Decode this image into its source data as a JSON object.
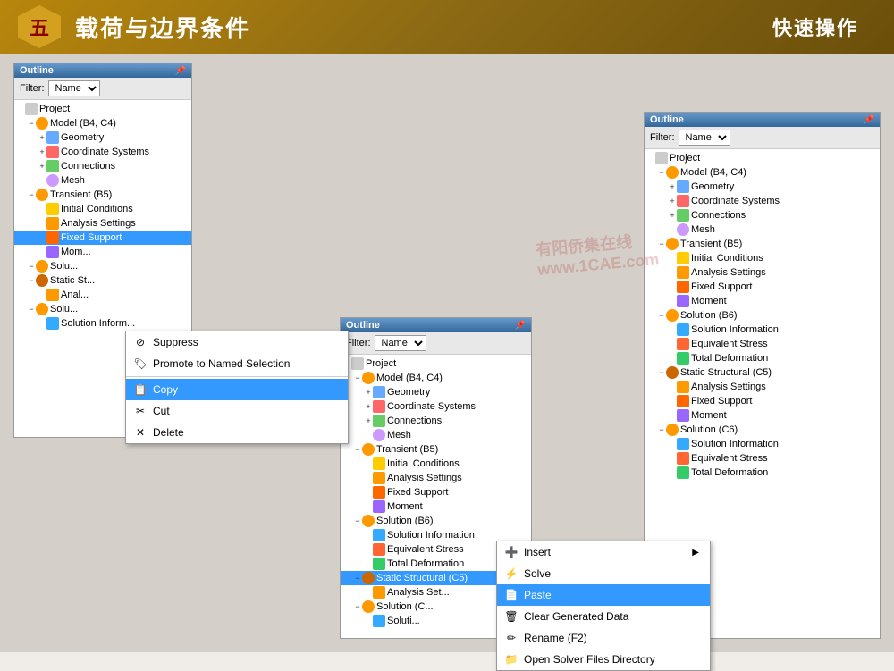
{
  "header": {
    "badge": "五",
    "title": "载荷与边界条件",
    "subtitle": "快速操作"
  },
  "panel1": {
    "title": "Outline",
    "filter_label": "Filter:",
    "filter_value": "Name",
    "tree": [
      {
        "id": "project",
        "label": "Project",
        "icon": "project",
        "indent": 0,
        "expand": ""
      },
      {
        "id": "model",
        "label": "Model (B4, C4)",
        "icon": "model",
        "indent": 1,
        "expand": "−"
      },
      {
        "id": "geometry",
        "label": "Geometry",
        "icon": "geometry",
        "indent": 2,
        "expand": "+"
      },
      {
        "id": "coord",
        "label": "Coordinate Systems",
        "icon": "coord",
        "indent": 2,
        "expand": "+"
      },
      {
        "id": "connect",
        "label": "Connections",
        "icon": "connect",
        "indent": 2,
        "expand": "+"
      },
      {
        "id": "mesh",
        "label": "Mesh",
        "icon": "mesh",
        "indent": 2,
        "expand": ""
      },
      {
        "id": "transient",
        "label": "Transient (B5)",
        "icon": "transient",
        "indent": 1,
        "expand": "−"
      },
      {
        "id": "init",
        "label": "Initial Conditions",
        "icon": "init",
        "indent": 2,
        "expand": ""
      },
      {
        "id": "analysis",
        "label": "Analysis Settings",
        "icon": "analysis",
        "indent": 2,
        "expand": ""
      },
      {
        "id": "fixed",
        "label": "Fixed Support",
        "icon": "fixed",
        "indent": 2,
        "expand": "",
        "selected": true
      },
      {
        "id": "moment",
        "label": "Mom...",
        "icon": "moment",
        "indent": 2,
        "expand": ""
      },
      {
        "id": "solu_b",
        "label": "Solu...",
        "icon": "solution",
        "indent": 1,
        "expand": "−"
      },
      {
        "id": "static_st",
        "label": "Static St...",
        "icon": "static",
        "indent": 1,
        "expand": "−"
      },
      {
        "id": "anal2",
        "label": "Anal...",
        "icon": "analysis",
        "indent": 2,
        "expand": ""
      },
      {
        "id": "solu_c",
        "label": "Solu...",
        "icon": "solution",
        "indent": 1,
        "expand": "−"
      },
      {
        "id": "sol_info2",
        "label": "Solution Inform...",
        "icon": "sol-info",
        "indent": 2,
        "expand": ""
      }
    ]
  },
  "context_menu1": {
    "items": [
      {
        "label": "Suppress",
        "icon": "suppress",
        "type": "item"
      },
      {
        "label": "Promote to Named Selection",
        "icon": "promote",
        "type": "item"
      },
      {
        "label": "Copy",
        "icon": "copy",
        "type": "item",
        "highlighted": true
      },
      {
        "label": "Cut",
        "icon": "cut",
        "type": "item"
      },
      {
        "label": "Delete",
        "icon": "delete",
        "type": "item"
      }
    ]
  },
  "panel2": {
    "title": "Outline",
    "filter_label": "Filter:",
    "filter_value": "Name",
    "tree": [
      {
        "id": "project",
        "label": "Project",
        "icon": "project",
        "indent": 0
      },
      {
        "id": "model",
        "label": "Model (B4, C4)",
        "icon": "model",
        "indent": 1,
        "expand": "−"
      },
      {
        "id": "geometry",
        "label": "Geometry",
        "icon": "geometry",
        "indent": 2,
        "expand": "+"
      },
      {
        "id": "coord",
        "label": "Coordinate Systems",
        "icon": "coord",
        "indent": 2,
        "expand": "+"
      },
      {
        "id": "connect",
        "label": "Connections",
        "icon": "connect",
        "indent": 2,
        "expand": "+"
      },
      {
        "id": "mesh",
        "label": "Mesh",
        "icon": "mesh",
        "indent": 2
      },
      {
        "id": "transient",
        "label": "Transient (B5)",
        "icon": "transient",
        "indent": 1,
        "expand": "−"
      },
      {
        "id": "init",
        "label": "Initial Conditions",
        "icon": "init",
        "indent": 2
      },
      {
        "id": "analysis",
        "label": "Analysis Settings",
        "icon": "analysis",
        "indent": 2
      },
      {
        "id": "fixed",
        "label": "Fixed Support",
        "icon": "fixed",
        "indent": 2
      },
      {
        "id": "moment",
        "label": "Moment",
        "icon": "moment",
        "indent": 2
      },
      {
        "id": "solution_b6",
        "label": "Solution (B6)",
        "icon": "solution",
        "indent": 1,
        "expand": "−"
      },
      {
        "id": "sol_info",
        "label": "Solution Information",
        "icon": "sol-info",
        "indent": 2
      },
      {
        "id": "equiv",
        "label": "Equivalent Stress",
        "icon": "equiv",
        "indent": 2
      },
      {
        "id": "deform",
        "label": "Total Deformation",
        "icon": "deform",
        "indent": 2
      },
      {
        "id": "static_c5",
        "label": "Static Structural (C5)",
        "icon": "static",
        "indent": 1,
        "expand": "−",
        "highlighted": true
      },
      {
        "id": "anal_set",
        "label": "Analysis Set...",
        "icon": "analysis",
        "indent": 2
      },
      {
        "id": "solu_c6q",
        "label": "Solution (C...",
        "icon": "solution",
        "indent": 1,
        "expand": "−"
      },
      {
        "id": "sol_c6",
        "label": "Soluti...",
        "icon": "sol-info",
        "indent": 2
      }
    ]
  },
  "context_menu2": {
    "items": [
      {
        "label": "Insert",
        "icon": "insert",
        "type": "submenu"
      },
      {
        "label": "Solve",
        "icon": "solve",
        "type": "item"
      },
      {
        "label": "Paste",
        "icon": "paste",
        "type": "item",
        "highlighted": true
      },
      {
        "label": "Clear Generated Data",
        "icon": "clear",
        "type": "item"
      },
      {
        "label": "Rename (F2)",
        "icon": "rename",
        "type": "item"
      },
      {
        "label": "Open Solver Files Directory",
        "icon": "folder",
        "type": "item"
      }
    ]
  },
  "panel3": {
    "title": "Outline",
    "filter_label": "Filter:",
    "filter_value": "Name",
    "tree": [
      {
        "id": "project",
        "label": "Project",
        "icon": "project",
        "indent": 0
      },
      {
        "id": "model",
        "label": "Model (B4, C4)",
        "icon": "model",
        "indent": 1,
        "expand": "−"
      },
      {
        "id": "geometry",
        "label": "Geometry",
        "icon": "geometry",
        "indent": 2,
        "expand": "+"
      },
      {
        "id": "coord",
        "label": "Coordinate Systems",
        "icon": "coord",
        "indent": 2,
        "expand": "+"
      },
      {
        "id": "connect",
        "label": "Connections",
        "icon": "connect",
        "indent": 2,
        "expand": "+"
      },
      {
        "id": "mesh",
        "label": "Mesh",
        "icon": "mesh",
        "indent": 2
      },
      {
        "id": "transient",
        "label": "Transient (B5)",
        "icon": "transient",
        "indent": 1,
        "expand": "−"
      },
      {
        "id": "init_cond",
        "label": "Initial Conditions",
        "icon": "init",
        "indent": 2
      },
      {
        "id": "anal_set",
        "label": "Analysis Settings",
        "icon": "analysis",
        "indent": 2
      },
      {
        "id": "fixed_sup",
        "label": "Fixed Support",
        "icon": "fixed",
        "indent": 2
      },
      {
        "id": "moment",
        "label": "Moment",
        "icon": "moment",
        "indent": 2
      },
      {
        "id": "solution_b6",
        "label": "Solution (B6)",
        "icon": "solution",
        "indent": 1,
        "expand": "−"
      },
      {
        "id": "sol_info_b",
        "label": "Solution Information",
        "icon": "sol-info",
        "indent": 2
      },
      {
        "id": "equiv_b",
        "label": "Equivalent Stress",
        "icon": "equiv",
        "indent": 2
      },
      {
        "id": "deform_b",
        "label": "Total Deformation",
        "icon": "deform",
        "indent": 2
      },
      {
        "id": "static_c5",
        "label": "Static Structural (C5)",
        "icon": "static",
        "indent": 1,
        "expand": "−"
      },
      {
        "id": "anal_set_c",
        "label": "Analysis Settings",
        "icon": "analysis",
        "indent": 2
      },
      {
        "id": "fixed_c",
        "label": "Fixed Support",
        "icon": "fixed",
        "indent": 2
      },
      {
        "id": "moment_c",
        "label": "Moment",
        "icon": "moment",
        "indent": 2
      },
      {
        "id": "solution_c6",
        "label": "Solution (C6)",
        "icon": "solution",
        "indent": 1,
        "expand": "−"
      },
      {
        "id": "sol_info_c",
        "label": "Solution Information",
        "icon": "sol-info",
        "indent": 2
      },
      {
        "id": "equiv_c",
        "label": "Equivalent Stress",
        "icon": "equiv",
        "indent": 2
      },
      {
        "id": "deform_c",
        "label": "Total Deformation",
        "icon": "deform",
        "indent": 2
      }
    ]
  },
  "watermark": "有阳 作在线\nwww.1CAE.com"
}
